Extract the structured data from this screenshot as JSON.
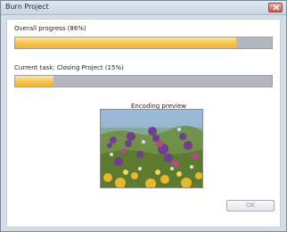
{
  "window": {
    "title": "Burn Project"
  },
  "overall_progress": {
    "label": "Overall progress (86%)",
    "value_percent": 86
  },
  "current_task": {
    "label": "Current task: Closing Project  (15%)",
    "value_percent": 15
  },
  "preview": {
    "label": "Encoding preview"
  },
  "buttons": {
    "ok_label": "OK"
  },
  "icons": {
    "close": "close-icon"
  },
  "colors": {
    "progress_fill": "#f6c24a",
    "progress_track": "#b3b8bf",
    "titlebar_close": "#c9574a"
  }
}
